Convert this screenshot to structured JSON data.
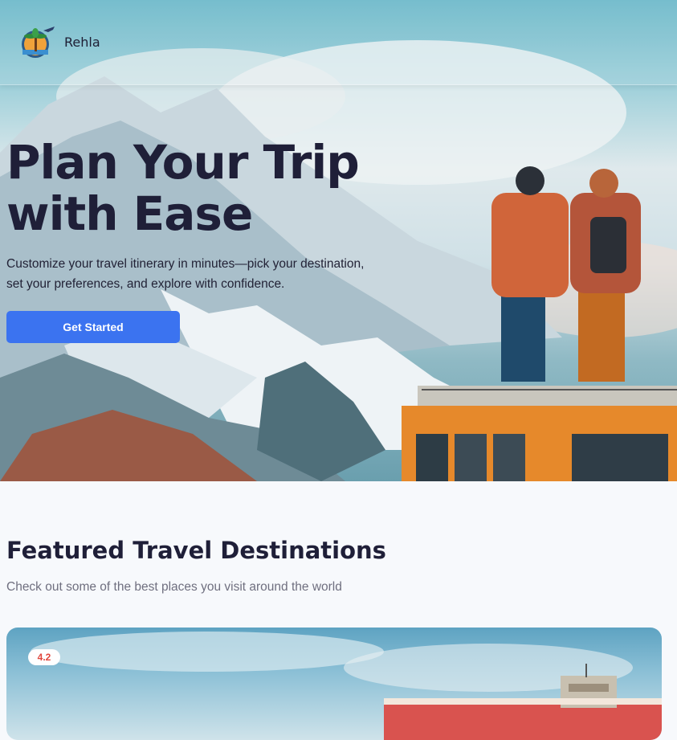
{
  "header": {
    "brand": "Rehla"
  },
  "hero": {
    "title_line1": "Plan Your Trip",
    "title_line2": "with Ease",
    "subtitle": "Customize your travel itinerary in minutes—pick your destination, set your preferences, and explore with confidence.",
    "cta_label": "Get Started"
  },
  "featured": {
    "title": "Featured Travel Destinations",
    "subtitle": "Check out some of the best places you visit around the world",
    "cards": [
      {
        "rating": "4.2"
      }
    ]
  },
  "colors": {
    "accent": "#3b73f0",
    "rating": "#e1463c",
    "heading": "#1f1f38"
  }
}
